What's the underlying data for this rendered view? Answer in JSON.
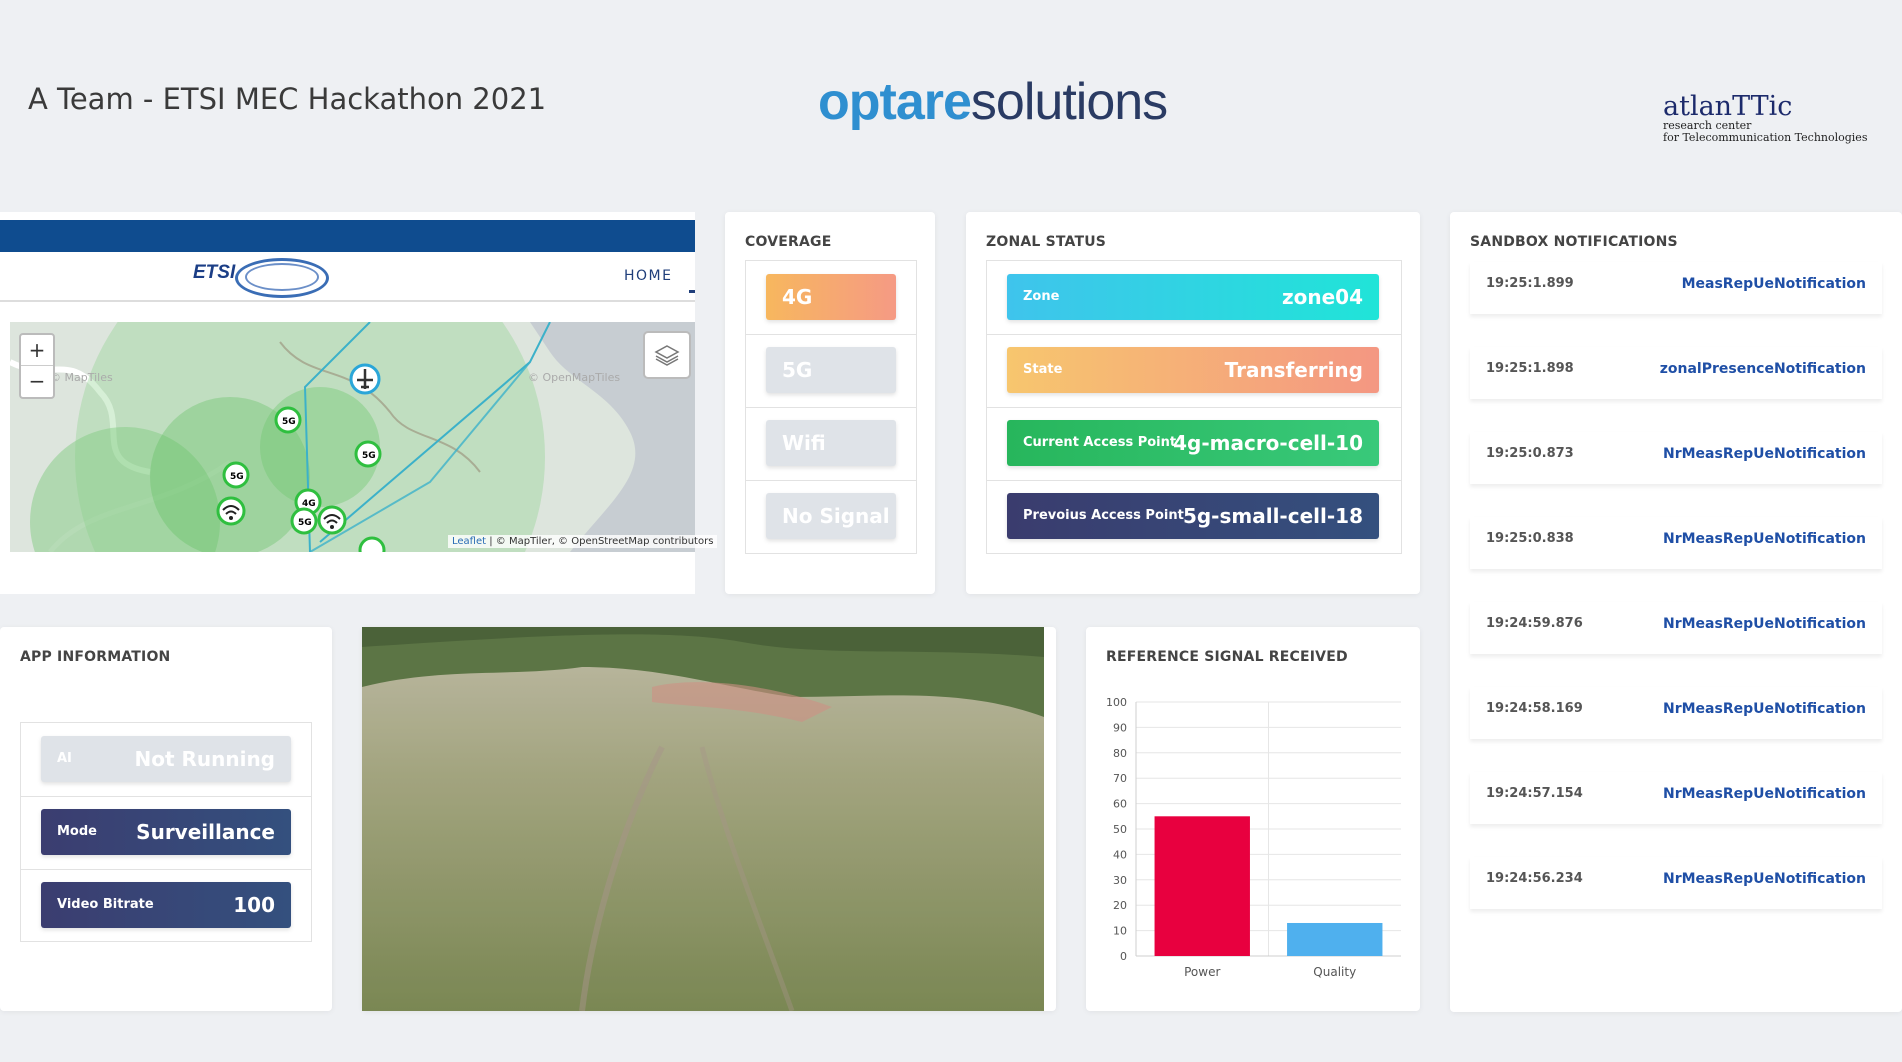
{
  "header": {
    "title": "A Team - ETSI MEC Hackathon 2021",
    "logo_optare_a": "optare",
    "logo_optare_b": "solutions",
    "logo_atlan_main": "atlanTTic",
    "logo_atlan_sub1": "research center",
    "logo_atlan_sub2": "for Telecommunication Technologies"
  },
  "map_panel": {
    "brand": "ETSI",
    "nav_home": "HOME",
    "zoom_in": "+",
    "zoom_out": "−",
    "attribution_leaflet": "Leaflet",
    "attribution_rest": " | © MapTiler, © OpenStreetMap contributors",
    "label_maptiles_left": "© MapTiles",
    "label_maptiles_right": "© OpenMapTiles"
  },
  "coverage": {
    "title": "COVERAGE",
    "items": [
      {
        "label": "4G",
        "active": true
      },
      {
        "label": "5G",
        "active": false
      },
      {
        "label": "Wifi",
        "active": false
      },
      {
        "label": "No Signal",
        "active": false
      }
    ]
  },
  "zonal_status": {
    "title": "ZONAL STATUS",
    "rows": [
      {
        "label": "Zone",
        "value": "zone04"
      },
      {
        "label": "State",
        "value": "Transferring"
      },
      {
        "label": "Current Access Point",
        "value": "4g-macro-cell-10"
      },
      {
        "label": "Prevoius Access Point",
        "value": "5g-small-cell-18"
      }
    ]
  },
  "notifications": {
    "title": "SANDBOX NOTIFICATIONS",
    "items": [
      {
        "time": "19:25:1.899",
        "name": "MeasRepUeNotification"
      },
      {
        "time": "19:25:1.898",
        "name": "zonalPresenceNotification"
      },
      {
        "time": "19:25:0.873",
        "name": "NrMeasRepUeNotification"
      },
      {
        "time": "19:25:0.838",
        "name": "NrMeasRepUeNotification"
      },
      {
        "time": "19:24:59.876",
        "name": "NrMeasRepUeNotification"
      },
      {
        "time": "19:24:58.169",
        "name": "NrMeasRepUeNotification"
      },
      {
        "time": "19:24:57.154",
        "name": "NrMeasRepUeNotification"
      },
      {
        "time": "19:24:56.234",
        "name": "NrMeasRepUeNotification"
      }
    ]
  },
  "app_info": {
    "title": "APP INFORMATION",
    "rows": [
      {
        "label": "AI",
        "value": "Not Running"
      },
      {
        "label": "Mode",
        "value": "Surveillance"
      },
      {
        "label": "Video Bitrate",
        "value": "100"
      }
    ]
  },
  "chart_data": {
    "type": "bar",
    "title": "REFERENCE SIGNAL RECEIVED",
    "categories": [
      "Power",
      "Quality"
    ],
    "values": [
      55,
      13
    ],
    "colors": [
      "#e8003f",
      "#4fb0ee"
    ],
    "ylim": [
      0,
      100
    ],
    "yticks": [
      0,
      10,
      20,
      30,
      40,
      50,
      60,
      70,
      80,
      90,
      100
    ],
    "grid": true
  },
  "colors": {
    "accent_blue": "#1f4fa6",
    "etsi_bar": "#0f4c8f",
    "gradient_orange": "#f7b26a",
    "gradient_cyan": "#22d4e0",
    "green": "#2fbf63",
    "navy": "#3a3f72"
  }
}
